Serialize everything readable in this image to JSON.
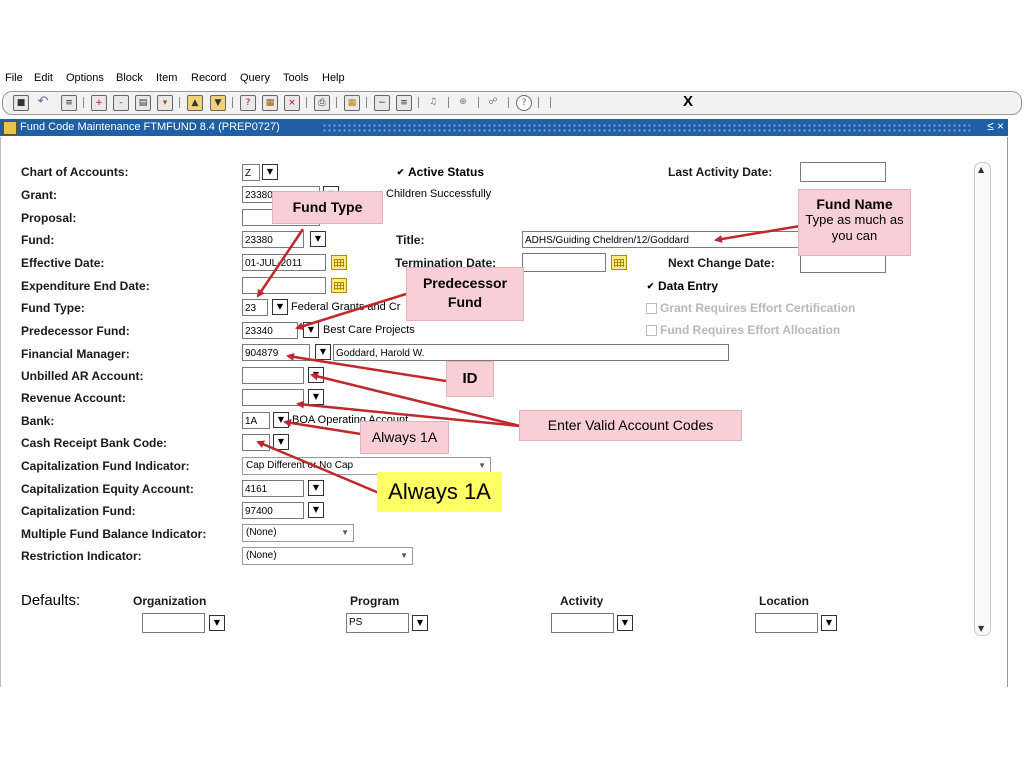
{
  "menu": [
    "File",
    "Edit",
    "Options",
    "Block",
    "Item",
    "Record",
    "Query",
    "Tools",
    "Help"
  ],
  "toolbar": {
    "exit_label": "X"
  },
  "window": {
    "title": "Fund Code Maintenance  FTMFUND  8.4  (PREP0727)",
    "controls": "≤ ×"
  },
  "labels": {
    "chart": "Chart of Accounts:",
    "grant": "Grant:",
    "proposal": "Proposal:",
    "fund": "Fund:",
    "effective_date": "Effective Date:",
    "expenditure_end": "Expenditure End Date:",
    "fund_type": "Fund Type:",
    "predecessor": "Predecessor Fund:",
    "financial_manager": "Financial Manager:",
    "unbilled_ar": "Unbilled AR Account:",
    "revenue": "Revenue Account:",
    "bank": "Bank:",
    "cash_receipt": "Cash Receipt Bank Code:",
    "cap_indicator": "Capitalization Fund Indicator:",
    "cap_equity": "Capitalization Equity Account:",
    "cap_fund": "Capitalization Fund:",
    "multi_fund": "Multiple Fund Balance Indicator:",
    "restriction": "Restriction Indicator:",
    "title": "Title:",
    "termination_date": "Termination Date:",
    "last_activity": "Last Activity Date:",
    "next_change": "Next Change Date:"
  },
  "values": {
    "chart": "Z",
    "grant": "23380",
    "grant_desc": "Children Successfully",
    "fund": "23380",
    "effective_date": "01-JUL-2011",
    "fund_type": "23",
    "fund_type_desc": "Federal Grants and Cr",
    "predecessor": "23340",
    "predecessor_desc": "Best Care Projects",
    "financial_manager": "904879",
    "financial_manager_name": "Goddard, Harold W.",
    "bank": "1A",
    "bank_desc": "BOA Operating Account",
    "cap_indicator": "Cap Different or No Cap",
    "cap_equity": "4161",
    "cap_fund": "97400",
    "multi_fund": "(None)",
    "restriction": "(None)",
    "title": "ADHS/Guiding Cheldren/12/Goddard"
  },
  "checkboxes": {
    "active_status": "Active Status",
    "data_entry": "Data Entry",
    "grant_effort_cert": "Grant Requires Effort Certification",
    "fund_effort_alloc": "Fund Requires Effort Allocation"
  },
  "defaults": {
    "heading": "Defaults:",
    "organization": "Organization",
    "program": "Program",
    "program_value": "PS",
    "activity": "Activity",
    "location": "Location"
  },
  "callouts": {
    "fund_type": "Fund Type",
    "fund_name_title": "Fund Name",
    "fund_name_body": "Type as much as you can",
    "predecessor": "Predecessor Fund",
    "id": "ID",
    "account_codes": "Enter Valid Account Codes",
    "always1a_small": "Always 1A",
    "always1a_big": "Always 1A"
  },
  "colors": {
    "callout_pink": "#f8cfd5",
    "callout_yellow": "#ffff66",
    "arrow_red": "#c0282d",
    "titlebar_blue": "#1f5fa5"
  }
}
